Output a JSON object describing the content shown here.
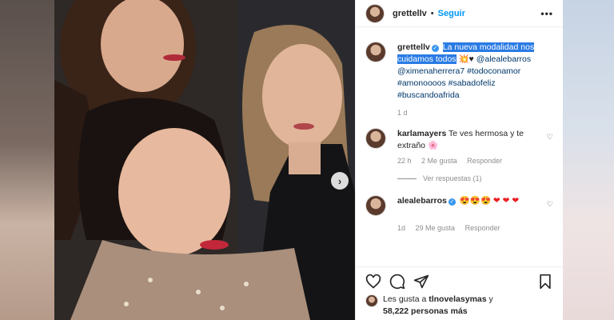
{
  "post": {
    "username": "grettellv",
    "follow_label": "Seguir",
    "separator": "•",
    "more_label": "•••",
    "next_label": "›"
  },
  "caption": {
    "username": "grettellv",
    "highlighted_text": "La nueva modalidad nos cuidamos todos",
    "emojis": "💥♥",
    "mention1": "@alealebarros",
    "mention2": "@ximenaherrera7",
    "hashtag1": "#todoconamor",
    "hashtag2": "#amonoooos",
    "hashtag3": "#sabadofeliz",
    "hashtag4": "#buscandoafrida",
    "time": "1 d"
  },
  "comments": [
    {
      "username": "karlamayers",
      "text": "Te ves hermosa y te extraño 🌸",
      "time": "22 h",
      "likes": "2 Me gusta",
      "reply_label": "Responder",
      "view_replies": "Ver respuestas (1)"
    },
    {
      "username": "alealebarros",
      "text": "😍😍😍 ❤ ❤ ❤",
      "time": "1d",
      "likes": "29 Me gusta",
      "reply_label": "Responder"
    }
  ],
  "likes_line": {
    "prefix": "Les gusta a ",
    "user": "tlnovelasymas",
    "middle": " y",
    "count": "58,222 personas más"
  },
  "icons": [
    "heart-icon",
    "comment-icon",
    "share-icon",
    "bookmark-icon",
    "verified-icon",
    "chevron-right-icon"
  ],
  "colors": {
    "link": "#0095f6",
    "highlight": "#2a7be4",
    "verified": "#3897f0",
    "hashtag": "#00376b"
  }
}
